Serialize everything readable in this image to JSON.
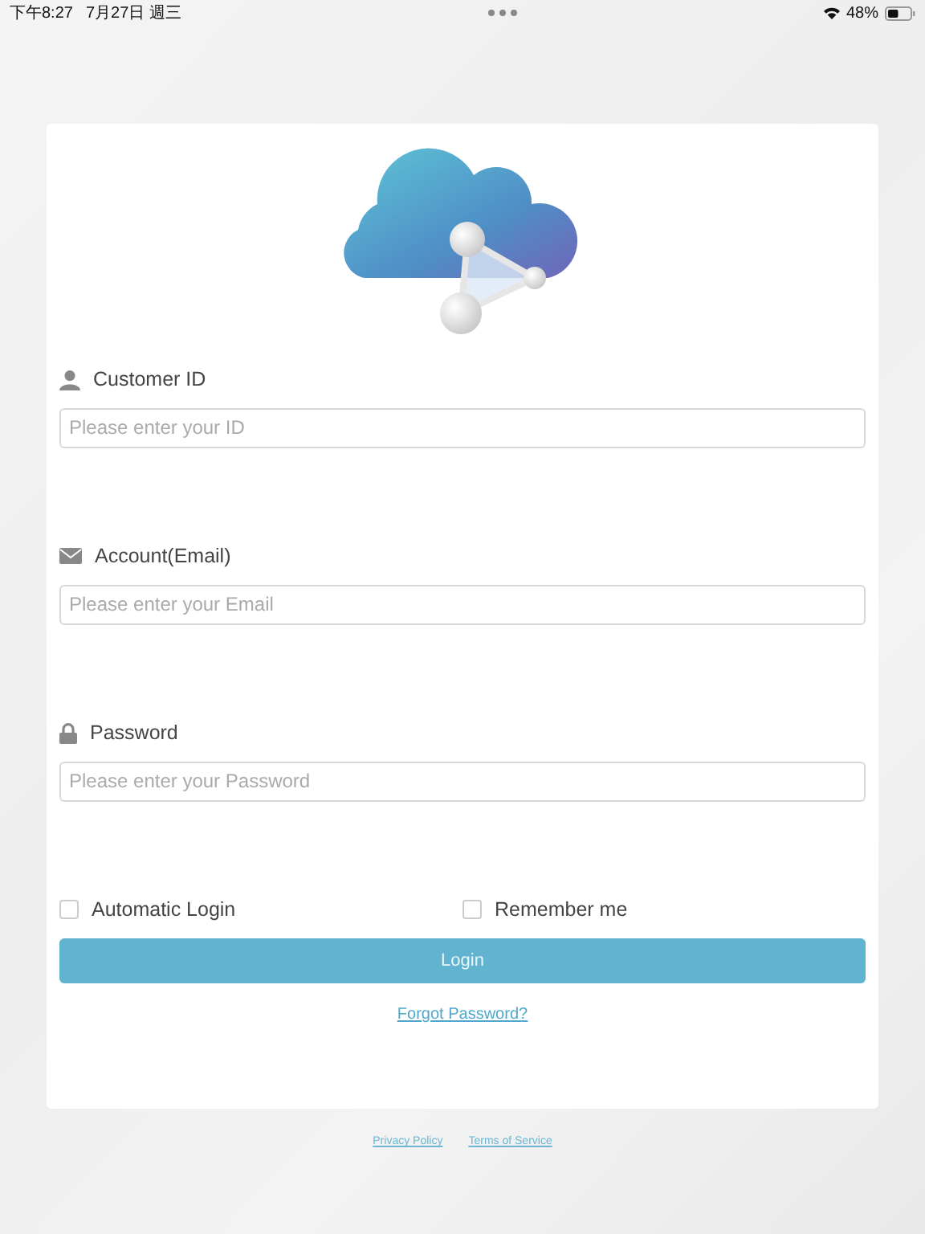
{
  "status_bar": {
    "time": "下午8:27",
    "date": "7月27日 週三",
    "battery": {
      "text": "48%",
      "level": 0.48
    }
  },
  "fields": [
    {
      "kind": "person",
      "label": "Customer ID",
      "placeholder": "Please enter your ID"
    },
    {
      "kind": "envelope",
      "label": "Account(Email)",
      "placeholder": "Please enter your Email"
    },
    {
      "kind": "lock",
      "label": "Password",
      "placeholder": "Please enter your Password"
    }
  ],
  "options": [
    {
      "label": "Automatic Login",
      "checked": false
    },
    {
      "label": "Remember me",
      "checked": false
    }
  ],
  "login_button": "Login",
  "forgot_link": "Forgot Password?",
  "footer_links": [
    "Privacy Policy",
    "Terms of Service"
  ]
}
